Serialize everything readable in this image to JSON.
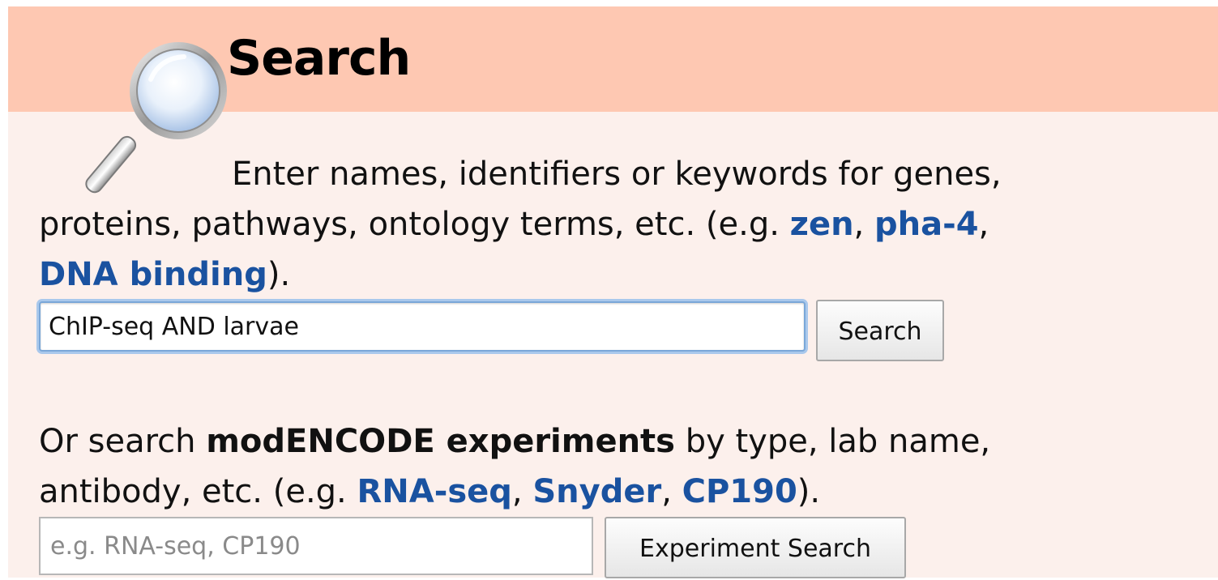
{
  "search_panel": {
    "title": "Search",
    "intro_text": "Enter names, identifiers or keywords for genes,",
    "intro_text_2": "proteins, pathways, ontology terms, etc. (e.g.",
    "examples": [
      "zen",
      "pha-4",
      "DNA binding"
    ],
    "input_value": "ChIP-seq AND larvae",
    "search_button_label": "Search"
  },
  "experiments": {
    "prefix": "Or search",
    "bold": "modENCODE experiments",
    "suffix": "by type, lab name,",
    "line2": "antibody, etc. (e.g.",
    "examples": [
      "RNA-seq",
      "Snyder",
      "CP190"
    ],
    "input_placeholder": "e.g. RNA-seq, CP190",
    "button_label": "Experiment Search"
  },
  "colors": {
    "header_bg": "#fec8b2",
    "panel_bg": "#fcf0ec",
    "link": "#1a52a0"
  },
  "icons": {
    "magnifier": "magnifying-glass-icon"
  }
}
